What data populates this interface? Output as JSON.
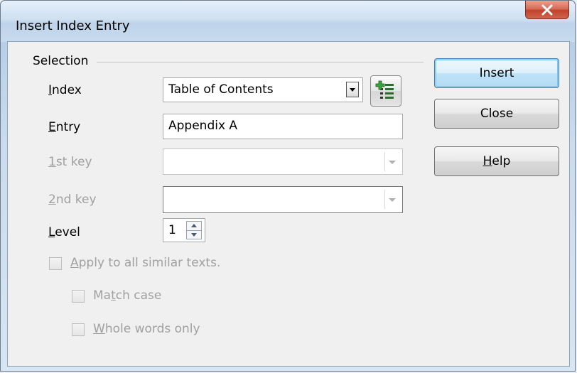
{
  "window": {
    "title": "Insert Index Entry"
  },
  "selection": {
    "group_label": "Selection",
    "index": {
      "label": "Index",
      "accel": "I",
      "rest": "ndex",
      "value": "Table of Contents"
    },
    "entry": {
      "label": "Entry",
      "accel": "E",
      "rest": "ntry",
      "value": "Appendix A"
    },
    "key1": {
      "label": "1st key",
      "accel": "1",
      "rest": "st key",
      "value": ""
    },
    "key2": {
      "label": "2nd key",
      "accel": "2",
      "rest": "nd key",
      "value": ""
    },
    "level": {
      "label": "Level",
      "accel": "L",
      "rest": "evel",
      "value": "1"
    }
  },
  "options": {
    "apply_all": {
      "label": "Apply to all similar texts.",
      "accel": "A",
      "rest": "pply to all similar texts.",
      "checked": false,
      "enabled": false
    },
    "match_case": {
      "label": "Match case",
      "pre": "Ma",
      "accel": "t",
      "rest": "ch case",
      "checked": false,
      "enabled": false
    },
    "whole_words": {
      "label": "Whole words only",
      "accel": "W",
      "rest": "hole words only",
      "checked": false,
      "enabled": false
    }
  },
  "buttons": {
    "insert": "Insert",
    "close": "Close",
    "help": {
      "label": "Help",
      "accel": "H",
      "rest": "elp"
    }
  },
  "icons": {
    "window_close": "close-x-icon",
    "new_index": "new-user-index-icon"
  },
  "colors": {
    "accent": "#3c7fb1",
    "disabled_text": "#a0a0a0",
    "close_button": "#c1432c"
  }
}
